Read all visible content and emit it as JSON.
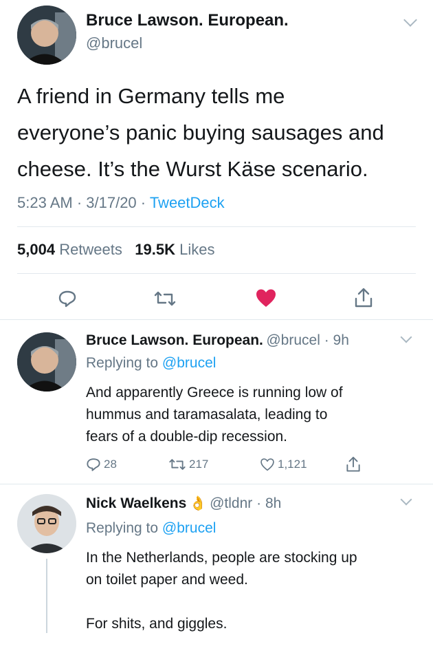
{
  "main_tweet": {
    "author_name": "Bruce Lawson. European.",
    "author_handle": "@brucel",
    "text_lines": [
      "A friend in Germany tells me",
      "everyone’s panic buying sausages and",
      "cheese. It’s the Wurst Käse scenario."
    ],
    "time": "5:23 AM · 3/17/20 · ",
    "source": "TweetDeck",
    "retweets_count": "5,004",
    "retweets_label": "Retweets",
    "likes_count": "19.5K",
    "likes_label": "Likes",
    "liked": true,
    "like_color": "#e0245e"
  },
  "replies": [
    {
      "author_name": "Bruce Lawson. European.",
      "meta": "@brucel · 9h",
      "replying_prefix": "Replying to ",
      "replying_to": "@brucel",
      "text_lines": [
        "And apparently Greece is running low of",
        "hummus and taramasalata, leading to",
        "fears of a double-dip recession."
      ],
      "reply_count": "28",
      "retweet_count": "217",
      "like_count": "1,121"
    },
    {
      "author_name": "Nick Waelkens",
      "emoji": "👌",
      "meta": "@tldnr · 8h",
      "replying_prefix": "Replying to ",
      "replying_to": "@brucel",
      "text_lines": [
        "In the Netherlands, people are stocking up",
        "on toilet paper and weed.",
        "",
        "For shits, and giggles."
      ]
    }
  ]
}
